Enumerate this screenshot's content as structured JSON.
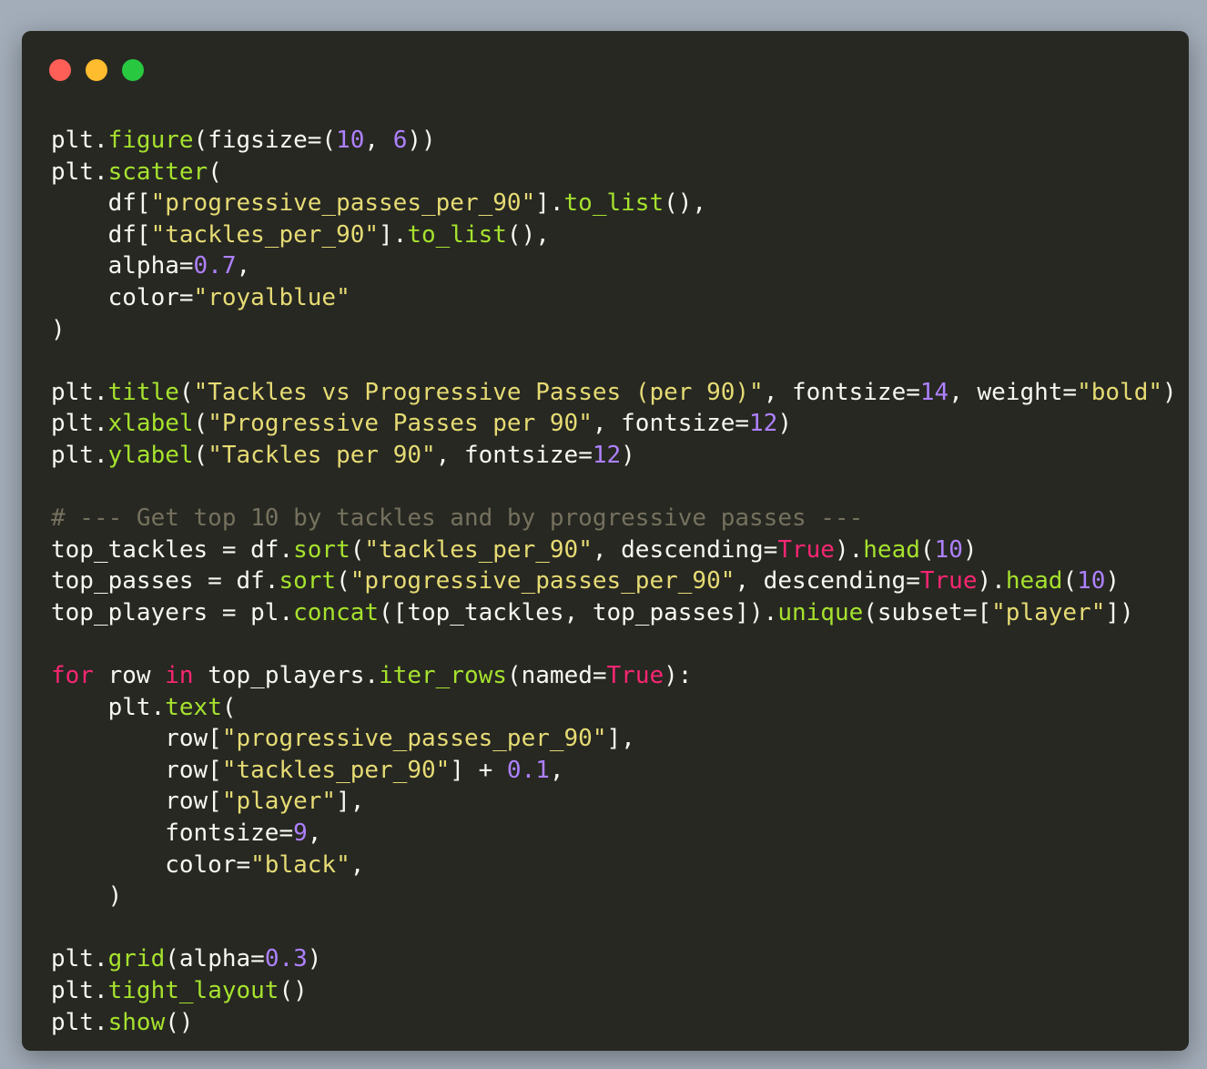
{
  "window": {
    "background": "#272822",
    "traffic_lights": [
      {
        "name": "close",
        "color": "#ff5f57"
      },
      {
        "name": "minimize",
        "color": "#febc2e"
      },
      {
        "name": "zoom",
        "color": "#28c840"
      }
    ]
  },
  "code": {
    "language": "python",
    "colors": {
      "plain": "#f8f8f2",
      "function": "#a6e22e",
      "string": "#e6db74",
      "number": "#ae81ff",
      "keyword": "#f92672",
      "comment": "#75715e"
    },
    "lines": [
      [
        [
          "plain",
          "plt."
        ],
        [
          "fn",
          "figure"
        ],
        [
          "plain",
          "(figsize=("
        ],
        [
          "num",
          "10"
        ],
        [
          "plain",
          ", "
        ],
        [
          "num",
          "6"
        ],
        [
          "plain",
          "))"
        ]
      ],
      [
        [
          "plain",
          "plt."
        ],
        [
          "fn",
          "scatter"
        ],
        [
          "plain",
          "("
        ]
      ],
      [
        [
          "plain",
          "    df["
        ],
        [
          "str",
          "\"progressive_passes_per_90\""
        ],
        [
          "plain",
          "]."
        ],
        [
          "fn",
          "to_list"
        ],
        [
          "plain",
          "(),"
        ]
      ],
      [
        [
          "plain",
          "    df["
        ],
        [
          "str",
          "\"tackles_per_90\""
        ],
        [
          "plain",
          "]."
        ],
        [
          "fn",
          "to_list"
        ],
        [
          "plain",
          "(),"
        ]
      ],
      [
        [
          "plain",
          "    alpha="
        ],
        [
          "num",
          "0.7"
        ],
        [
          "plain",
          ","
        ]
      ],
      [
        [
          "plain",
          "    color="
        ],
        [
          "str",
          "\"royalblue\""
        ]
      ],
      [
        [
          "plain",
          ")"
        ]
      ],
      [],
      [
        [
          "plain",
          "plt."
        ],
        [
          "fn",
          "title"
        ],
        [
          "plain",
          "("
        ],
        [
          "str",
          "\"Tackles vs Progressive Passes (per 90)\""
        ],
        [
          "plain",
          ", fontsize="
        ],
        [
          "num",
          "14"
        ],
        [
          "plain",
          ", weight="
        ],
        [
          "str",
          "\"bold\""
        ],
        [
          "plain",
          ")"
        ]
      ],
      [
        [
          "plain",
          "plt."
        ],
        [
          "fn",
          "xlabel"
        ],
        [
          "plain",
          "("
        ],
        [
          "str",
          "\"Progressive Passes per 90\""
        ],
        [
          "plain",
          ", fontsize="
        ],
        [
          "num",
          "12"
        ],
        [
          "plain",
          ")"
        ]
      ],
      [
        [
          "plain",
          "plt."
        ],
        [
          "fn",
          "ylabel"
        ],
        [
          "plain",
          "("
        ],
        [
          "str",
          "\"Tackles per 90\""
        ],
        [
          "plain",
          ", fontsize="
        ],
        [
          "num",
          "12"
        ],
        [
          "plain",
          ")"
        ]
      ],
      [],
      [
        [
          "com",
          "# --- Get top 10 by tackles and by progressive passes ---"
        ]
      ],
      [
        [
          "plain",
          "top_tackles = df."
        ],
        [
          "fn",
          "sort"
        ],
        [
          "plain",
          "("
        ],
        [
          "str",
          "\"tackles_per_90\""
        ],
        [
          "plain",
          ", descending="
        ],
        [
          "kw",
          "True"
        ],
        [
          "plain",
          ")."
        ],
        [
          "fn",
          "head"
        ],
        [
          "plain",
          "("
        ],
        [
          "num",
          "10"
        ],
        [
          "plain",
          ")"
        ]
      ],
      [
        [
          "plain",
          "top_passes = df."
        ],
        [
          "fn",
          "sort"
        ],
        [
          "plain",
          "("
        ],
        [
          "str",
          "\"progressive_passes_per_90\""
        ],
        [
          "plain",
          ", descending="
        ],
        [
          "kw",
          "True"
        ],
        [
          "plain",
          ")."
        ],
        [
          "fn",
          "head"
        ],
        [
          "plain",
          "("
        ],
        [
          "num",
          "10"
        ],
        [
          "plain",
          ")"
        ]
      ],
      [
        [
          "plain",
          "top_players = pl."
        ],
        [
          "fn",
          "concat"
        ],
        [
          "plain",
          "([top_tackles, top_passes])."
        ],
        [
          "fn",
          "unique"
        ],
        [
          "plain",
          "(subset=["
        ],
        [
          "str",
          "\"player\""
        ],
        [
          "plain",
          "])"
        ]
      ],
      [],
      [
        [
          "kw",
          "for"
        ],
        [
          "plain",
          " row "
        ],
        [
          "kw",
          "in"
        ],
        [
          "plain",
          " top_players."
        ],
        [
          "fn",
          "iter_rows"
        ],
        [
          "plain",
          "(named="
        ],
        [
          "kw",
          "True"
        ],
        [
          "plain",
          "):"
        ]
      ],
      [
        [
          "plain",
          "    plt."
        ],
        [
          "fn",
          "text"
        ],
        [
          "plain",
          "("
        ]
      ],
      [
        [
          "plain",
          "        row["
        ],
        [
          "str",
          "\"progressive_passes_per_90\""
        ],
        [
          "plain",
          "],"
        ]
      ],
      [
        [
          "plain",
          "        row["
        ],
        [
          "str",
          "\"tackles_per_90\""
        ],
        [
          "plain",
          "] + "
        ],
        [
          "num",
          "0.1"
        ],
        [
          "plain",
          ","
        ]
      ],
      [
        [
          "plain",
          "        row["
        ],
        [
          "str",
          "\"player\""
        ],
        [
          "plain",
          "],"
        ]
      ],
      [
        [
          "plain",
          "        fontsize="
        ],
        [
          "num",
          "9"
        ],
        [
          "plain",
          ","
        ]
      ],
      [
        [
          "plain",
          "        color="
        ],
        [
          "str",
          "\"black\""
        ],
        [
          "plain",
          ","
        ]
      ],
      [
        [
          "plain",
          "    )"
        ]
      ],
      [],
      [
        [
          "plain",
          "plt."
        ],
        [
          "fn",
          "grid"
        ],
        [
          "plain",
          "(alpha="
        ],
        [
          "num",
          "0.3"
        ],
        [
          "plain",
          ")"
        ]
      ],
      [
        [
          "plain",
          "plt."
        ],
        [
          "fn",
          "tight_layout"
        ],
        [
          "plain",
          "()"
        ]
      ],
      [
        [
          "plain",
          "plt."
        ],
        [
          "fn",
          "show"
        ],
        [
          "plain",
          "()"
        ]
      ]
    ]
  }
}
